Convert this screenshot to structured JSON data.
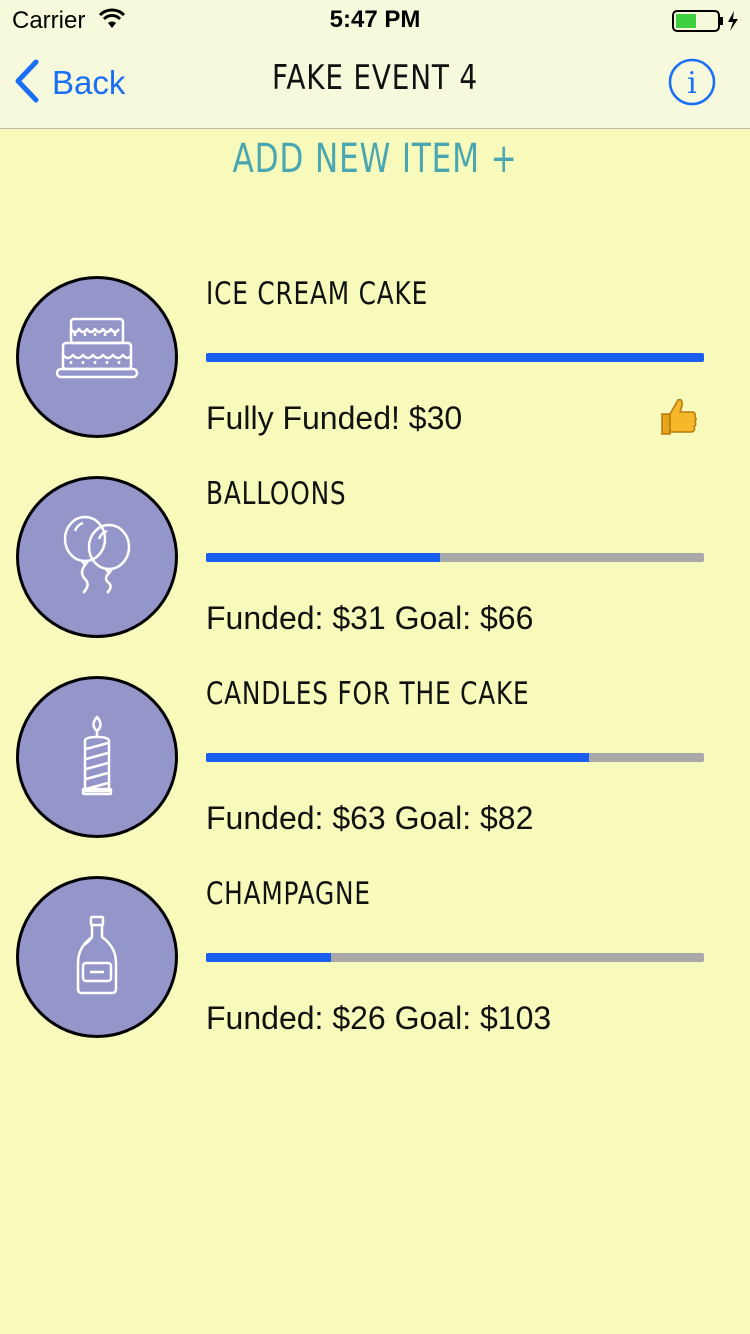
{
  "status_bar": {
    "carrier": "Carrier",
    "time": "5:47 PM"
  },
  "nav": {
    "back_label": "Back",
    "title": "FAKE EVENT 4",
    "info_icon": "info-icon"
  },
  "add_item_label": "ADD NEW ITEM +",
  "colors": {
    "accent": "#1a6ff5",
    "background": "#f7fabb",
    "circle": "#9496ca",
    "progress": "#1a5ef0",
    "track": "#a9a9a9",
    "add_item": "#4aa7b2"
  },
  "items": [
    {
      "name": "ICE CREAM CAKE",
      "icon": "cake-icon",
      "funded": 30,
      "goal": 30,
      "progress": 1.0,
      "status": "Fully Funded! $30",
      "badge": "thumbs-up-icon"
    },
    {
      "name": "BALLOONS",
      "icon": "balloons-icon",
      "funded": 31,
      "goal": 66,
      "progress": 0.47,
      "status": "Funded: $31 Goal: $66"
    },
    {
      "name": "CANDLES FOR THE CAKE",
      "icon": "candle-icon",
      "funded": 63,
      "goal": 82,
      "progress": 0.77,
      "status": "Funded: $63 Goal: $82"
    },
    {
      "name": "CHAMPAGNE",
      "icon": "champagne-icon",
      "funded": 26,
      "goal": 103,
      "progress": 0.25,
      "status": "Funded: $26 Goal: $103"
    }
  ]
}
